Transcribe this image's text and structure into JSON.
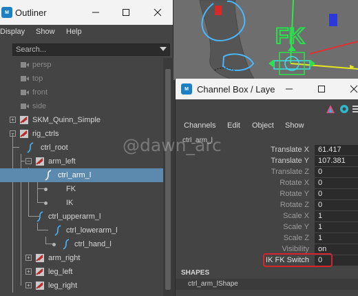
{
  "outliner": {
    "title": "Outliner",
    "app_icon": "maya-app-icon",
    "menu": [
      "Display",
      "Show",
      "Help"
    ],
    "search": {
      "placeholder": "Search..."
    },
    "items": [
      {
        "label": "persp",
        "type": "camera"
      },
      {
        "label": "top",
        "type": "camera"
      },
      {
        "label": "front",
        "type": "camera"
      },
      {
        "label": "side",
        "type": "camera"
      },
      {
        "label": "SKM_Quinn_Simple",
        "type": "skeleton"
      },
      {
        "label": "rig_ctrls",
        "type": "skeleton"
      },
      {
        "label": "ctrl_root",
        "type": "curve"
      },
      {
        "label": "arm_left",
        "type": "skeleton"
      },
      {
        "label": "ctrl_arm_l",
        "type": "curve",
        "selected": true
      },
      {
        "label": "FK",
        "type": "locator"
      },
      {
        "label": "IK",
        "type": "locator"
      },
      {
        "label": "ctrl_upperarm_l",
        "type": "curve"
      },
      {
        "label": "ctrl_lowerarm_l",
        "type": "curve"
      },
      {
        "label": "ctrl_hand_l",
        "type": "curve"
      },
      {
        "label": "arm_right",
        "type": "skeleton"
      },
      {
        "label": "leg_left",
        "type": "skeleton"
      },
      {
        "label": "leg_right",
        "type": "skeleton"
      }
    ]
  },
  "viewport": {
    "overlay_text": "FK"
  },
  "channel_box": {
    "title": "Channel Box / Laye",
    "menu": [
      "Channels",
      "Edit",
      "Object",
      "Show"
    ],
    "object_name": "ctrl_arm_l",
    "attributes": [
      {
        "name": "Translate X",
        "value": "61.417"
      },
      {
        "name": "Translate Y",
        "value": "107.381"
      },
      {
        "name": "Translate Z",
        "value": "0"
      },
      {
        "name": "Rotate X",
        "value": "0"
      },
      {
        "name": "Rotate Y",
        "value": "0"
      },
      {
        "name": "Rotate Z",
        "value": "0"
      },
      {
        "name": "Scale X",
        "value": "1"
      },
      {
        "name": "Scale Y",
        "value": "1"
      },
      {
        "name": "Scale Z",
        "value": "1"
      },
      {
        "name": "Visibility",
        "value": "on"
      },
      {
        "name": "IK FK Switch",
        "value": "0"
      }
    ],
    "shapes_header": "SHAPES",
    "shape_name": "ctrl_arm_lShape"
  },
  "watermark": "@dawn_arc",
  "colors": {
    "selection": "#5c89ae",
    "highlight": "#d8252c",
    "ctrl_curve": "#4ab8ff",
    "fk_text": "#27e24c"
  }
}
